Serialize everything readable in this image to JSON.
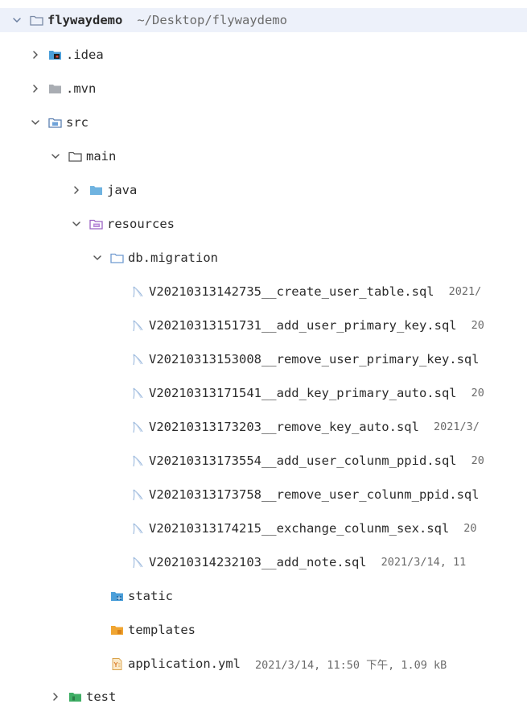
{
  "colors": {
    "selection": "#edf1fa",
    "plain_folder": "#7a8aa6",
    "blue_folder": "#4c9fd9",
    "orange_folder": "#f0a531",
    "purple_folder": "#9b63c4",
    "green_folder": "#3fae65",
    "grey_folder": "#a9adb3",
    "sql_file": "#7aa6d6",
    "yml_file": "#d9a24a"
  },
  "tree": {
    "root": {
      "name": "flywaydemo",
      "path": "~/Desktop/flywaydemo",
      "expanded": true,
      "icon": "folder-plain-icon"
    },
    "idea": {
      "name": ".idea",
      "expanded": false,
      "icon": "folder-idea-icon"
    },
    "mvn": {
      "name": ".mvn",
      "expanded": false,
      "icon": "folder-grey-icon"
    },
    "src": {
      "name": "src",
      "expanded": true,
      "icon": "folder-source-icon"
    },
    "main": {
      "name": "main",
      "expanded": true,
      "icon": "folder-plain-icon"
    },
    "java": {
      "name": "java",
      "expanded": false,
      "icon": "folder-blue-icon"
    },
    "resources": {
      "name": "resources",
      "expanded": true,
      "icon": "folder-resources-icon"
    },
    "db_migration": {
      "name": "db.migration",
      "expanded": true,
      "icon": "folder-plain-icon"
    },
    "migrations": [
      {
        "name": "V20210313142735__create_user_table.sql",
        "meta": "2021/"
      },
      {
        "name": "V20210313151731__add_user_primary_key.sql",
        "meta": "20"
      },
      {
        "name": "V20210313153008__remove_user_primary_key.sql",
        "meta": ""
      },
      {
        "name": "V20210313171541__add_key_primary_auto.sql",
        "meta": "20"
      },
      {
        "name": "V20210313173203__remove_key_auto.sql",
        "meta": "2021/3/"
      },
      {
        "name": "V20210313173554__add_user_colunm_ppid.sql",
        "meta": "20"
      },
      {
        "name": "V20210313173758__remove_user_colunm_ppid.sql",
        "meta": ""
      },
      {
        "name": "V20210313174215__exchange_colunm_sex.sql",
        "meta": "20"
      },
      {
        "name": "V20210314232103__add_note.sql",
        "meta": "2021/3/14, 11"
      }
    ],
    "static": {
      "name": "static",
      "icon": "folder-static-icon"
    },
    "templates": {
      "name": "templates",
      "icon": "folder-templates-icon"
    },
    "application": {
      "name": "application.yml",
      "meta": "2021/3/14, 11:50 下午, 1.09 kB",
      "icon": "yml-file-icon"
    },
    "test": {
      "name": "test",
      "expanded": false,
      "icon": "folder-test-icon"
    }
  }
}
